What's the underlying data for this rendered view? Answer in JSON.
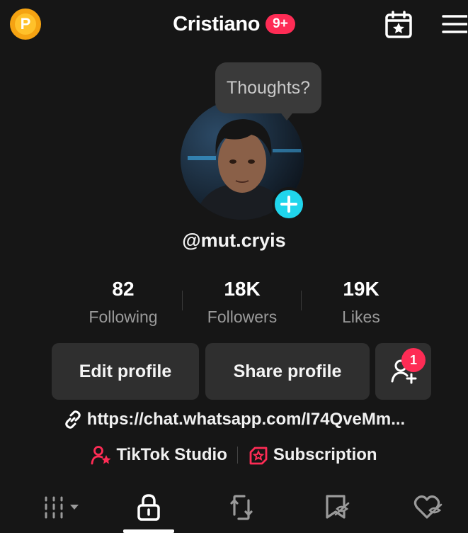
{
  "header": {
    "coin_letter": "P",
    "title": "Cristiano",
    "notification_count": "9+"
  },
  "profile": {
    "bubble_text": "Thoughts?",
    "username": "@mut.cryis"
  },
  "stats": [
    {
      "value": "82",
      "label": "Following"
    },
    {
      "value": "18K",
      "label": "Followers"
    },
    {
      "value": "19K",
      "label": "Likes"
    }
  ],
  "buttons": {
    "edit": "Edit profile",
    "share": "Share profile",
    "add_friends_badge": "1"
  },
  "bio": {
    "link": "https://chat.whatsapp.com/I74QveMm..."
  },
  "shortcuts": {
    "studio": "TikTok Studio",
    "subscription": "Subscription"
  },
  "colors": {
    "accent": "#fe2c55",
    "plus": "#20d5ec",
    "coin": "#f5a312"
  },
  "tabs": [
    "videos-grid-icon",
    "private-lock-icon",
    "repost-icon",
    "favorites-icon",
    "liked-icon"
  ],
  "active_tab": 1
}
